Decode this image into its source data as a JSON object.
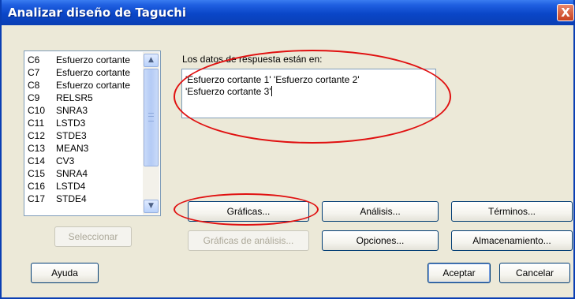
{
  "window": {
    "title": "Analizar diseño de Taguchi",
    "close_label": "X"
  },
  "columns": [
    {
      "id": "C6",
      "name": "Esfuerzo cortante"
    },
    {
      "id": "C7",
      "name": "Esfuerzo cortante"
    },
    {
      "id": "C8",
      "name": "Esfuerzo cortante"
    },
    {
      "id": "C9",
      "name": "RELSR5"
    },
    {
      "id": "C10",
      "name": "SNRA3"
    },
    {
      "id": "C11",
      "name": "LSTD3"
    },
    {
      "id": "C12",
      "name": "STDE3"
    },
    {
      "id": "C13",
      "name": "MEAN3"
    },
    {
      "id": "C14",
      "name": "CV3"
    },
    {
      "id": "C15",
      "name": "SNRA4"
    },
    {
      "id": "C16",
      "name": "LSTD4"
    },
    {
      "id": "C17",
      "name": "STDE4"
    }
  ],
  "response": {
    "label": "Los datos de respuesta están en:",
    "line1": "'Esfuerzo cortante 1' 'Esfuerzo cortante 2'",
    "line2": "'Esfuerzo cortante 3'"
  },
  "buttons": {
    "select": "Seleccionar",
    "graphs": "Gráficas...",
    "analysis": "Análisis...",
    "terms": "Términos...",
    "analysis_graphs": "Gráficas de análisis...",
    "options": "Opciones...",
    "storage": "Almacenamiento...",
    "help": "Ayuda",
    "ok": "Aceptar",
    "cancel": "Cancelar"
  },
  "colors": {
    "annotation": "#e01010",
    "titlebar": "#0a46c8"
  }
}
